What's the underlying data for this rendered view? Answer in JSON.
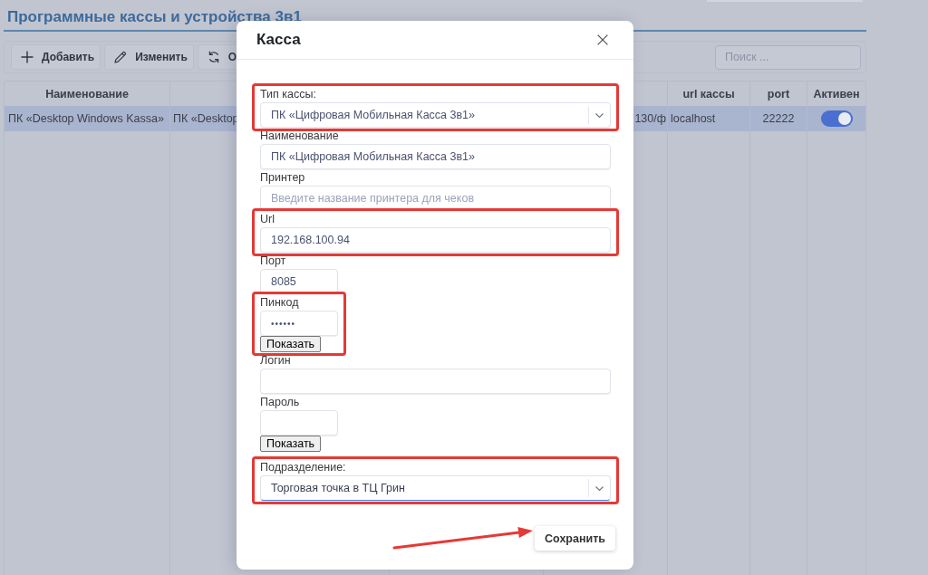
{
  "page": {
    "title": "Программные кассы и устройства 3в1"
  },
  "toolbar": {
    "buttons": [
      {
        "kind": "add",
        "label": "Добавить"
      },
      {
        "kind": "edit",
        "label": "Изменить"
      },
      {
        "kind": "refresh",
        "label": "О"
      }
    ],
    "search": {
      "placeholder": "Поиск ..."
    }
  },
  "table": {
    "columns": [
      {
        "heading": "Наименование"
      },
      {
        "heading": "url кассы"
      },
      {
        "heading": "port"
      },
      {
        "heading": "Активен"
      }
    ],
    "rows": [
      {
        "name": "ПК «Desktop Windows Kassa»",
        "column_2": "ПК «Desktop",
        "column_4": "130/ф",
        "url": "localhost",
        "port": "22222",
        "active": true,
        "selected": true
      }
    ]
  },
  "dialog": {
    "title": "Касса",
    "fields": [
      {
        "kind": "select",
        "label": "Тип кассы:",
        "value": "ПК «Цифровая Мобильная Касса 3в1»",
        "focused": false,
        "highlighted": true
      },
      {
        "kind": "text",
        "label": "Наименование",
        "value": "ПК «Цифровая Мобильная Касса 3в1»",
        "highlighted": false
      },
      {
        "kind": "text",
        "label": "Принтер",
        "placeholder": "Введите название принтера для чеков",
        "highlighted": false
      },
      {
        "kind": "text",
        "label": "Url",
        "value": "192.168.100.94",
        "highlighted": true
      },
      {
        "kind": "short",
        "label": "Порт",
        "value": "8085",
        "highlighted": false
      },
      {
        "kind": "secret",
        "label": "Пинкод",
        "value": "••••••",
        "button": "Показать",
        "highlighted": true
      },
      {
        "kind": "text",
        "label": "Логин",
        "highlighted": false
      },
      {
        "kind": "secret",
        "label": "Пароль",
        "button": "Показать",
        "highlighted": false
      },
      {
        "kind": "select",
        "label": "Подразделение:",
        "value": "Торговая точка в ТЦ Грин",
        "focused": true,
        "highlighted": true
      }
    ],
    "save_button": {
      "label": "Сохранить",
      "highlighted": true
    }
  }
}
